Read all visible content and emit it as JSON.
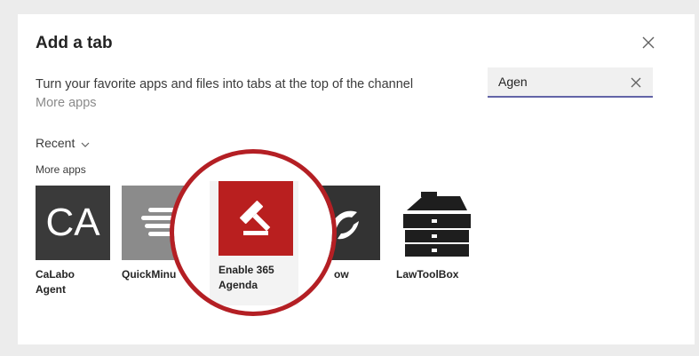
{
  "dialog": {
    "title": "Add a tab",
    "subtitle": "Turn your favorite apps and files into tabs at the top of the channel",
    "more_apps_link": "More apps",
    "close_icon": "close-icon"
  },
  "search": {
    "value": "Agen",
    "clear_icon": "clear-icon"
  },
  "filter": {
    "label": "Recent",
    "icon": "chevron-down-icon"
  },
  "section": {
    "label": "More apps"
  },
  "apps": [
    {
      "tile_text": "CA",
      "name_line1": "CaLabo",
      "name_line2": "Agent",
      "icon": "ca-monogram-icon"
    },
    {
      "tile_text": "",
      "name_line1": "QuickMinu",
      "name_line2": "",
      "icon": "quickminutes-lines-icon"
    },
    {
      "tile_text": "",
      "name_line1": "Enable 365",
      "name_line2": "Agenda",
      "icon": "gavel-icon"
    },
    {
      "tile_text": "",
      "name_line1": "ow",
      "name_line2": "",
      "icon": "flow-icon"
    },
    {
      "tile_text": "",
      "name_line1": "LawToolBox",
      "name_line2": "",
      "icon": "toolbox-icon"
    }
  ],
  "colors": {
    "highlight_ring": "#b41f24",
    "accent_underline": "#6264a7",
    "enable_tile": "#b91f1f"
  }
}
